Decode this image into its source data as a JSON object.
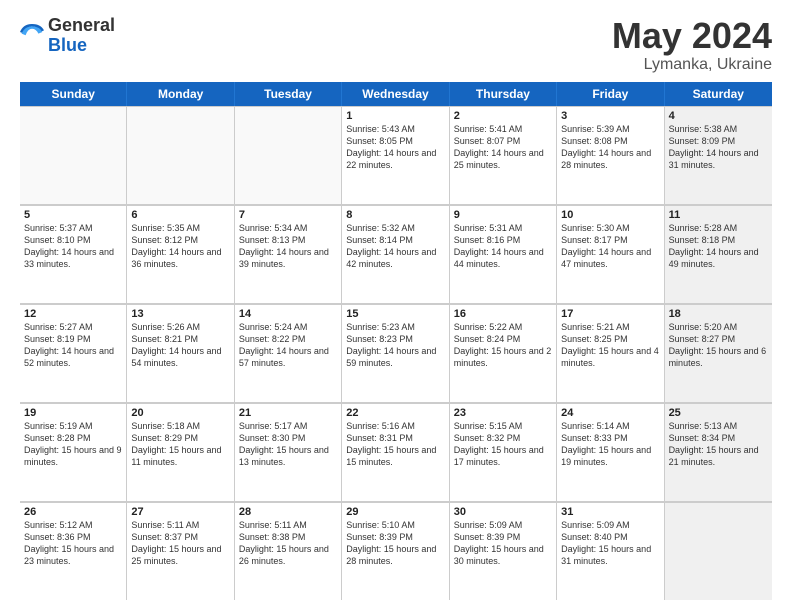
{
  "logo": {
    "general": "General",
    "blue": "Blue"
  },
  "title": "May 2024",
  "subtitle": "Lymanka, Ukraine",
  "header_days": [
    "Sunday",
    "Monday",
    "Tuesday",
    "Wednesday",
    "Thursday",
    "Friday",
    "Saturday"
  ],
  "weeks": [
    [
      {
        "day": "",
        "sunrise": "",
        "sunset": "",
        "daylight": "",
        "shaded": false
      },
      {
        "day": "",
        "sunrise": "",
        "sunset": "",
        "daylight": "",
        "shaded": false
      },
      {
        "day": "",
        "sunrise": "",
        "sunset": "",
        "daylight": "",
        "shaded": false
      },
      {
        "day": "1",
        "sunrise": "Sunrise: 5:43 AM",
        "sunset": "Sunset: 8:05 PM",
        "daylight": "Daylight: 14 hours and 22 minutes.",
        "shaded": false
      },
      {
        "day": "2",
        "sunrise": "Sunrise: 5:41 AM",
        "sunset": "Sunset: 8:07 PM",
        "daylight": "Daylight: 14 hours and 25 minutes.",
        "shaded": false
      },
      {
        "day": "3",
        "sunrise": "Sunrise: 5:39 AM",
        "sunset": "Sunset: 8:08 PM",
        "daylight": "Daylight: 14 hours and 28 minutes.",
        "shaded": false
      },
      {
        "day": "4",
        "sunrise": "Sunrise: 5:38 AM",
        "sunset": "Sunset: 8:09 PM",
        "daylight": "Daylight: 14 hours and 31 minutes.",
        "shaded": true
      }
    ],
    [
      {
        "day": "5",
        "sunrise": "Sunrise: 5:37 AM",
        "sunset": "Sunset: 8:10 PM",
        "daylight": "Daylight: 14 hours and 33 minutes.",
        "shaded": false
      },
      {
        "day": "6",
        "sunrise": "Sunrise: 5:35 AM",
        "sunset": "Sunset: 8:12 PM",
        "daylight": "Daylight: 14 hours and 36 minutes.",
        "shaded": false
      },
      {
        "day": "7",
        "sunrise": "Sunrise: 5:34 AM",
        "sunset": "Sunset: 8:13 PM",
        "daylight": "Daylight: 14 hours and 39 minutes.",
        "shaded": false
      },
      {
        "day": "8",
        "sunrise": "Sunrise: 5:32 AM",
        "sunset": "Sunset: 8:14 PM",
        "daylight": "Daylight: 14 hours and 42 minutes.",
        "shaded": false
      },
      {
        "day": "9",
        "sunrise": "Sunrise: 5:31 AM",
        "sunset": "Sunset: 8:16 PM",
        "daylight": "Daylight: 14 hours and 44 minutes.",
        "shaded": false
      },
      {
        "day": "10",
        "sunrise": "Sunrise: 5:30 AM",
        "sunset": "Sunset: 8:17 PM",
        "daylight": "Daylight: 14 hours and 47 minutes.",
        "shaded": false
      },
      {
        "day": "11",
        "sunrise": "Sunrise: 5:28 AM",
        "sunset": "Sunset: 8:18 PM",
        "daylight": "Daylight: 14 hours and 49 minutes.",
        "shaded": true
      }
    ],
    [
      {
        "day": "12",
        "sunrise": "Sunrise: 5:27 AM",
        "sunset": "Sunset: 8:19 PM",
        "daylight": "Daylight: 14 hours and 52 minutes.",
        "shaded": false
      },
      {
        "day": "13",
        "sunrise": "Sunrise: 5:26 AM",
        "sunset": "Sunset: 8:21 PM",
        "daylight": "Daylight: 14 hours and 54 minutes.",
        "shaded": false
      },
      {
        "day": "14",
        "sunrise": "Sunrise: 5:24 AM",
        "sunset": "Sunset: 8:22 PM",
        "daylight": "Daylight: 14 hours and 57 minutes.",
        "shaded": false
      },
      {
        "day": "15",
        "sunrise": "Sunrise: 5:23 AM",
        "sunset": "Sunset: 8:23 PM",
        "daylight": "Daylight: 14 hours and 59 minutes.",
        "shaded": false
      },
      {
        "day": "16",
        "sunrise": "Sunrise: 5:22 AM",
        "sunset": "Sunset: 8:24 PM",
        "daylight": "Daylight: 15 hours and 2 minutes.",
        "shaded": false
      },
      {
        "day": "17",
        "sunrise": "Sunrise: 5:21 AM",
        "sunset": "Sunset: 8:25 PM",
        "daylight": "Daylight: 15 hours and 4 minutes.",
        "shaded": false
      },
      {
        "day": "18",
        "sunrise": "Sunrise: 5:20 AM",
        "sunset": "Sunset: 8:27 PM",
        "daylight": "Daylight: 15 hours and 6 minutes.",
        "shaded": true
      }
    ],
    [
      {
        "day": "19",
        "sunrise": "Sunrise: 5:19 AM",
        "sunset": "Sunset: 8:28 PM",
        "daylight": "Daylight: 15 hours and 9 minutes.",
        "shaded": false
      },
      {
        "day": "20",
        "sunrise": "Sunrise: 5:18 AM",
        "sunset": "Sunset: 8:29 PM",
        "daylight": "Daylight: 15 hours and 11 minutes.",
        "shaded": false
      },
      {
        "day": "21",
        "sunrise": "Sunrise: 5:17 AM",
        "sunset": "Sunset: 8:30 PM",
        "daylight": "Daylight: 15 hours and 13 minutes.",
        "shaded": false
      },
      {
        "day": "22",
        "sunrise": "Sunrise: 5:16 AM",
        "sunset": "Sunset: 8:31 PM",
        "daylight": "Daylight: 15 hours and 15 minutes.",
        "shaded": false
      },
      {
        "day": "23",
        "sunrise": "Sunrise: 5:15 AM",
        "sunset": "Sunset: 8:32 PM",
        "daylight": "Daylight: 15 hours and 17 minutes.",
        "shaded": false
      },
      {
        "day": "24",
        "sunrise": "Sunrise: 5:14 AM",
        "sunset": "Sunset: 8:33 PM",
        "daylight": "Daylight: 15 hours and 19 minutes.",
        "shaded": false
      },
      {
        "day": "25",
        "sunrise": "Sunrise: 5:13 AM",
        "sunset": "Sunset: 8:34 PM",
        "daylight": "Daylight: 15 hours and 21 minutes.",
        "shaded": true
      }
    ],
    [
      {
        "day": "26",
        "sunrise": "Sunrise: 5:12 AM",
        "sunset": "Sunset: 8:36 PM",
        "daylight": "Daylight: 15 hours and 23 minutes.",
        "shaded": false
      },
      {
        "day": "27",
        "sunrise": "Sunrise: 5:11 AM",
        "sunset": "Sunset: 8:37 PM",
        "daylight": "Daylight: 15 hours and 25 minutes.",
        "shaded": false
      },
      {
        "day": "28",
        "sunrise": "Sunrise: 5:11 AM",
        "sunset": "Sunset: 8:38 PM",
        "daylight": "Daylight: 15 hours and 26 minutes.",
        "shaded": false
      },
      {
        "day": "29",
        "sunrise": "Sunrise: 5:10 AM",
        "sunset": "Sunset: 8:39 PM",
        "daylight": "Daylight: 15 hours and 28 minutes.",
        "shaded": false
      },
      {
        "day": "30",
        "sunrise": "Sunrise: 5:09 AM",
        "sunset": "Sunset: 8:39 PM",
        "daylight": "Daylight: 15 hours and 30 minutes.",
        "shaded": false
      },
      {
        "day": "31",
        "sunrise": "Sunrise: 5:09 AM",
        "sunset": "Sunset: 8:40 PM",
        "daylight": "Daylight: 15 hours and 31 minutes.",
        "shaded": false
      },
      {
        "day": "",
        "sunrise": "",
        "sunset": "",
        "daylight": "",
        "shaded": true
      }
    ]
  ]
}
